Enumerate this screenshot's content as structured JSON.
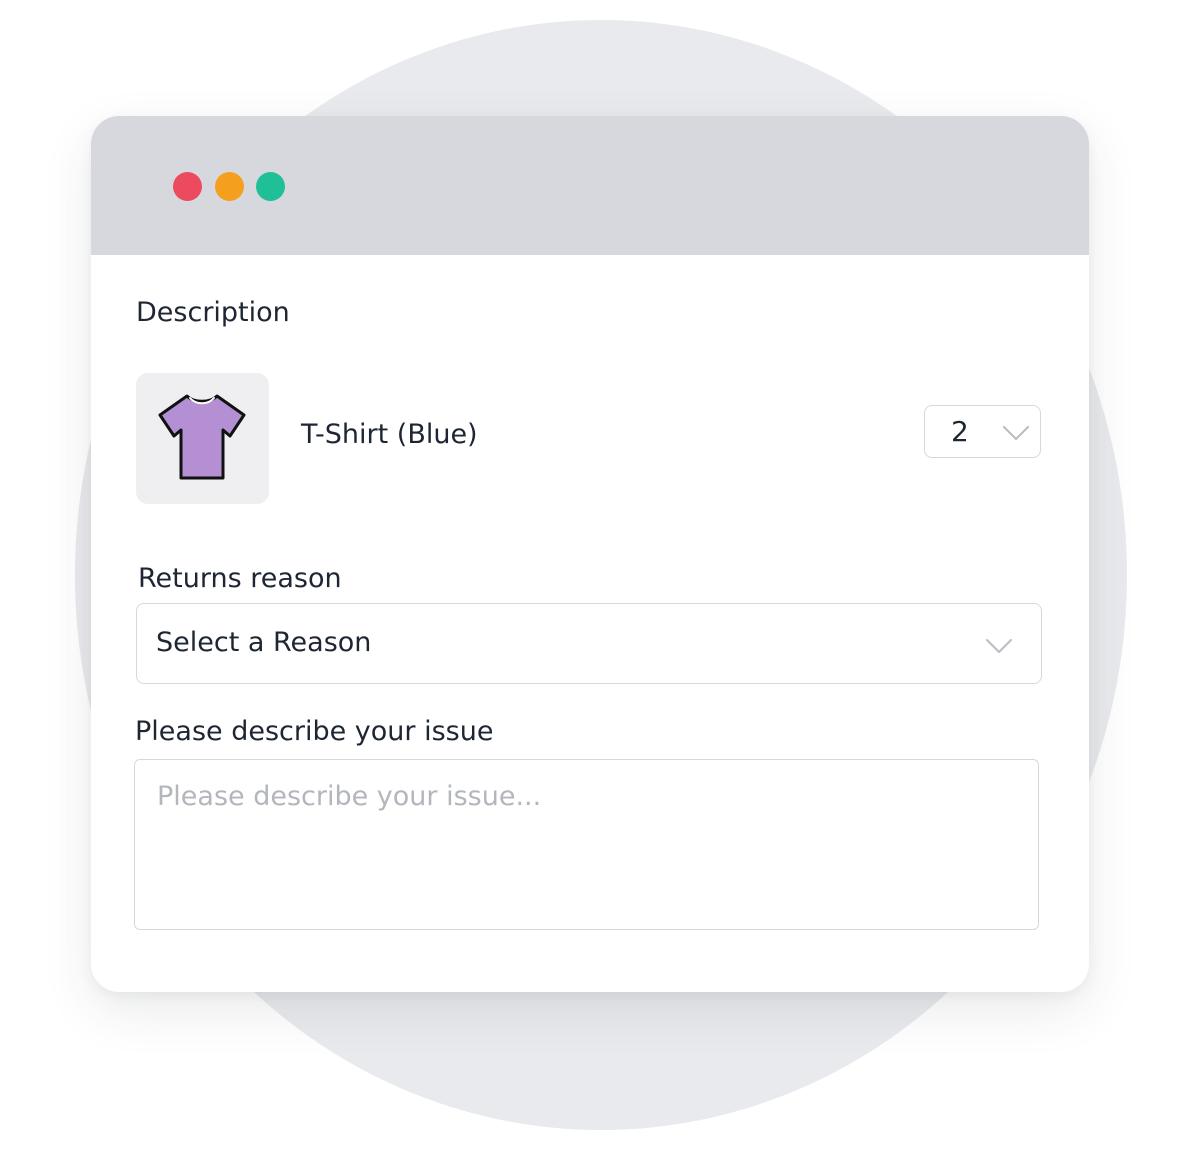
{
  "window": {
    "controls": [
      {
        "name": "close",
        "color": "#ec4a5e"
      },
      {
        "name": "minimize",
        "color": "#f49f1e"
      },
      {
        "name": "maximize",
        "color": "#1fbf97"
      }
    ]
  },
  "form": {
    "description_label": "Description",
    "product": {
      "icon": "t-shirt-icon",
      "name": "T-Shirt (Blue)",
      "quantity": "2"
    },
    "returns_reason": {
      "label": "Returns reason",
      "value": "Select a Reason"
    },
    "issue": {
      "label": "Please describe your issue",
      "placeholder": "Please describe your issue...",
      "value": ""
    }
  },
  "colors": {
    "titlebar": "#d7d8dd",
    "text": "#1e2633",
    "border": "#d6d8dd",
    "shirt_fill": "#b48fd4",
    "placeholder": "#b3b6bc"
  }
}
